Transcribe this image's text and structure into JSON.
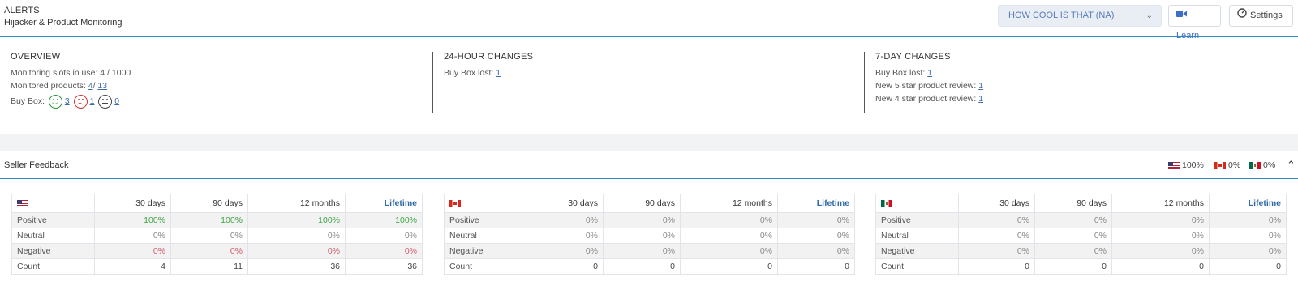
{
  "header": {
    "title": "ALERTS",
    "subtitle": "Hijacker & Product Monitoring",
    "account_select": "HOW COOL IS THAT (NA)",
    "learn_label": "Learn",
    "settings_label": "Settings"
  },
  "overview": {
    "heading": "OVERVIEW",
    "slots_label": "Monitoring slots in use: 4  / 1000",
    "monitored_label": "Monitored products:",
    "monitored_a": "4",
    "monitored_sep": "/",
    "monitored_b": "13",
    "buybox_label": "Buy Box:",
    "buybox_happy": "3",
    "buybox_sad": "1",
    "buybox_neutral": "0"
  },
  "changes_24h": {
    "heading": "24-HOUR CHANGES",
    "buybox_lost_label": "Buy Box lost:",
    "buybox_lost_value": "1"
  },
  "changes_7d": {
    "heading": "7-DAY CHANGES",
    "buybox_lost_label": "Buy Box lost:",
    "buybox_lost_value": "1",
    "review5_label": "New 5 star product review:",
    "review5_value": "1",
    "review4_label": "New 4 star product review:",
    "review4_value": "1"
  },
  "seller_feedback": {
    "title": "Seller Feedback",
    "us_pct": "100%",
    "ca_pct": "0%",
    "mx_pct": "0%",
    "columns": [
      "30 days",
      "90 days",
      "12 months",
      "Lifetime"
    ],
    "row_labels": [
      "Positive",
      "Neutral",
      "Negative",
      "Count"
    ],
    "tables": [
      {
        "country": "us",
        "rows": [
          [
            "100%",
            "100%",
            "100%",
            "100%"
          ],
          [
            "0%",
            "0%",
            "0%",
            "0%"
          ],
          [
            "0%",
            "0%",
            "0%",
            "0%"
          ],
          [
            "4",
            "11",
            "36",
            "36"
          ]
        ]
      },
      {
        "country": "ca",
        "rows": [
          [
            "0%",
            "0%",
            "0%",
            "0%"
          ],
          [
            "0%",
            "0%",
            "0%",
            "0%"
          ],
          [
            "0%",
            "0%",
            "0%",
            "0%"
          ],
          [
            "0",
            "0",
            "0",
            "0"
          ]
        ]
      },
      {
        "country": "mx",
        "rows": [
          [
            "0%",
            "0%",
            "0%",
            "0%"
          ],
          [
            "0%",
            "0%",
            "0%",
            "0%"
          ],
          [
            "0%",
            "0%",
            "0%",
            "0%"
          ],
          [
            "0",
            "0",
            "0",
            "0"
          ]
        ]
      }
    ]
  },
  "icons": {
    "learn": "video-icon",
    "settings": "gauge-icon",
    "select": "chevron-down-icon",
    "collapse": "chevron-up-icon"
  }
}
